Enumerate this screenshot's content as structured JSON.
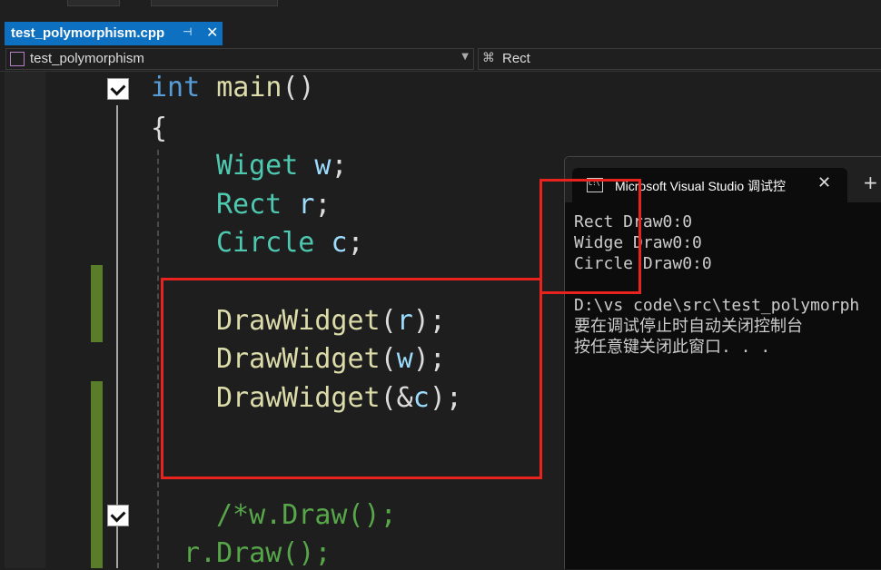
{
  "tab": {
    "title": "test_polymorphism.cpp",
    "pin_icon": "pin-icon",
    "close_glyph": "✕"
  },
  "navbar": {
    "project": "test_polymorphism",
    "scope": "Rect"
  },
  "code": {
    "line1": {
      "kw": "int",
      "name": "main",
      "parens": "()"
    },
    "line2": "{",
    "line3": {
      "type": "Wiget",
      "var": "w",
      "end": ";"
    },
    "line4": {
      "type": "Rect",
      "var": "r",
      "end": ";"
    },
    "line5": {
      "type": "Circle",
      "var": "c",
      "end": ";"
    },
    "line7": {
      "fn": "DrawWidget",
      "open": "(",
      "arg": "r",
      "close": ");"
    },
    "line8": {
      "fn": "DrawWidget",
      "open": "(",
      "arg": "w",
      "close": ");"
    },
    "line9": {
      "fn": "DrawWidget",
      "open": "(&",
      "arg": "c",
      "close": ");"
    },
    "line12": "/*w.Draw();",
    "line13": "r.Draw();"
  },
  "console": {
    "title": "Microsoft Visual Studio 调试控",
    "close_glyph": "✕",
    "new_tab_glyph": "+",
    "lines": [
      "Rect Draw0:0",
      "Widge Draw0:0",
      "Circle Draw0:0",
      "",
      "D:\\vs code\\src\\test_polymorph",
      "要在调试停止时自动关闭控制台",
      "按任意键关闭此窗口. . ."
    ]
  },
  "colors": {
    "keyword": "#569cd6",
    "function": "#dcdcaa",
    "type": "#4ec9b0",
    "variable": "#9cdcfe",
    "annotation": "#e8221c",
    "tab_active": "#0e70c0"
  }
}
